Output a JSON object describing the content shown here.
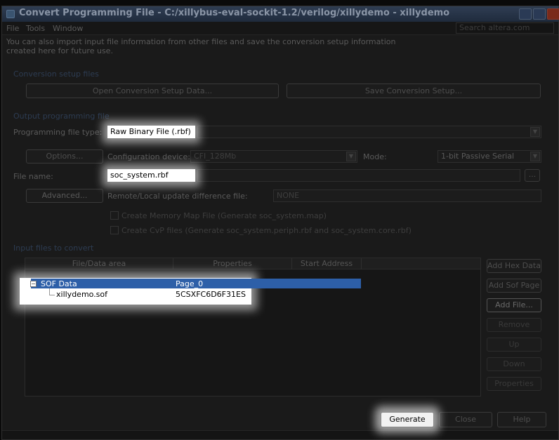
{
  "window": {
    "title": "Convert Programming File - C:/xillybus-eval-sockit-1.2/verilog/xillydemo - xillydemo",
    "colors": {
      "title_bar": "#2a3a55",
      "selection": "#2d5fa8",
      "highlight": "#ffffff"
    }
  },
  "menu": {
    "items": [
      "File",
      "Tools",
      "Window"
    ],
    "search_placeholder": "Search altera.com"
  },
  "intro_text": "You can also import input file information from other files and save the conversion setup information created here for future use.",
  "conversion_setup": {
    "heading": "Conversion setup files",
    "open_label": "Open Conversion Setup Data...",
    "save_label": "Save Conversion Setup..."
  },
  "output": {
    "heading": "Output programming file",
    "file_type_label": "Programming file type:",
    "file_type_value": "Raw Binary File (.rbf)",
    "options_label": "Options...",
    "config_device_label": "Configuration device:",
    "config_device_value": "CFI_128Mb",
    "mode_label": "Mode:",
    "mode_value": "1-bit Passive Serial",
    "file_name_label": "File name:",
    "file_name_value": "soc_system.rbf",
    "browse_label": "...",
    "advanced_label": "Advanced...",
    "remote_label": "Remote/Local update difference file:",
    "remote_value": "NONE",
    "map_checkbox_label": "Create Memory Map File (Generate soc_system.map)",
    "cvp_checkbox_label": "Create CvP files (Generate soc_system.periph.rbf and soc_system.core.rbf)"
  },
  "input": {
    "heading": "Input files to convert",
    "columns": [
      "File/Data area",
      "Properties",
      "Start Address"
    ],
    "rows": [
      {
        "name": "SOF Data",
        "properties": "Page_0",
        "start": "",
        "expanded": true,
        "selected": true
      },
      {
        "name": "xillydemo.sof",
        "properties": "5CSXFC6D6F31ES",
        "start": "",
        "selected": false
      }
    ],
    "side_buttons": [
      "Add Hex Data",
      "Add Sof Page",
      "Add File...",
      "Remove",
      "Up",
      "Down",
      "Properties"
    ]
  },
  "footer": {
    "generate_label": "Generate",
    "close_label": "Close",
    "help_label": "Help"
  }
}
